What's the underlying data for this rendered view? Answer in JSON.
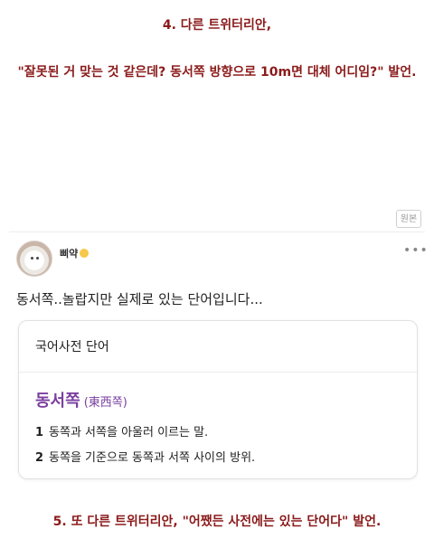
{
  "captions": {
    "line1": "4. 다른 트위터리안,",
    "line2": "\"잘못된 거 맞는 것 같은데? 동서쪽 방향으로 10m면 대체 어디임?\" 발언.",
    "line3": "5. 또 다른 트위터리안, \"어쨌든 사전에는 있는 단어다\" 발언."
  },
  "source_badge": "원본",
  "post": {
    "username": "삐약",
    "username_icon": "chick-emoji-icon",
    "more_icon": "more-dots-icon",
    "text": "동서쪽..놀랍지만 실제로 있는 단어입니다..."
  },
  "dictionary_card": {
    "header": "국어사전 단어",
    "word": "동서쪽",
    "hanja": "(東西쪽)",
    "definitions": [
      {
        "num": "1",
        "text": "동쪽과 서쪽을 아울러 이르는 말."
      },
      {
        "num": "2",
        "text": "동쪽을 기준으로 동쪽과 서쪽 사이의 방위."
      }
    ]
  },
  "colors": {
    "caption_red": "#8b1a1a",
    "dict_word_purple": "#7a3fa0"
  }
}
